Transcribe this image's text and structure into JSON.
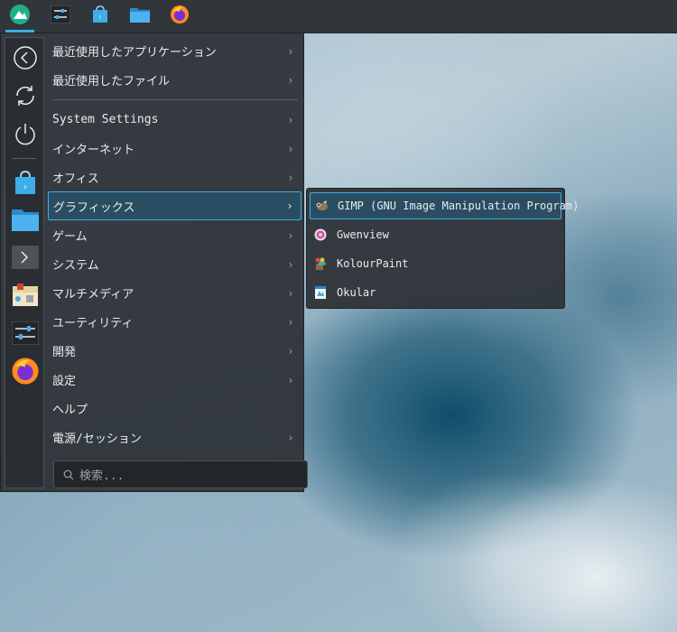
{
  "taskbar": {
    "launcher_icon": "kde-menu-icon",
    "pinned": [
      "system-settings-icon",
      "discover-store-icon",
      "dolphin-files-icon",
      "firefox-icon"
    ]
  },
  "sidebar": {
    "buttons": [
      "back-icon",
      "refresh-icon",
      "power-icon",
      "discover-store-icon",
      "files-folder-icon",
      "terminal-icon",
      "archive-icon",
      "settings-sliders-icon",
      "firefox-icon"
    ]
  },
  "menu": {
    "items": [
      {
        "label": "最近使用したアプリケーション",
        "has_submenu": true
      },
      {
        "label": "最近使用したファイル",
        "has_submenu": true
      },
      {
        "label": "System Settings",
        "has_submenu": true
      },
      {
        "label": "インターネット",
        "has_submenu": true
      },
      {
        "label": "オフィス",
        "has_submenu": true
      },
      {
        "label": "グラフィックス",
        "has_submenu": true,
        "selected": true
      },
      {
        "label": "ゲーム",
        "has_submenu": true
      },
      {
        "label": "システム",
        "has_submenu": true
      },
      {
        "label": "マルチメディア",
        "has_submenu": true
      },
      {
        "label": "ユーティリティ",
        "has_submenu": true
      },
      {
        "label": "開発",
        "has_submenu": true
      },
      {
        "label": "設定",
        "has_submenu": true
      },
      {
        "label": "ヘルプ",
        "has_submenu": false
      },
      {
        "label": "電源/セッション",
        "has_submenu": true
      }
    ],
    "chevron": "›"
  },
  "search": {
    "placeholder": "検索..."
  },
  "submenu": {
    "items": [
      {
        "label": "GIMP (GNU Image Manipulation Program)",
        "icon": "gimp-icon",
        "selected": true
      },
      {
        "label": "Gwenview",
        "icon": "gwenview-icon"
      },
      {
        "label": "KolourPaint",
        "icon": "kolourpaint-icon"
      },
      {
        "label": "Okular",
        "icon": "okular-icon"
      }
    ]
  },
  "colors": {
    "accent": "#3daee9",
    "panel": "#31363b",
    "text": "#e8ecef"
  }
}
